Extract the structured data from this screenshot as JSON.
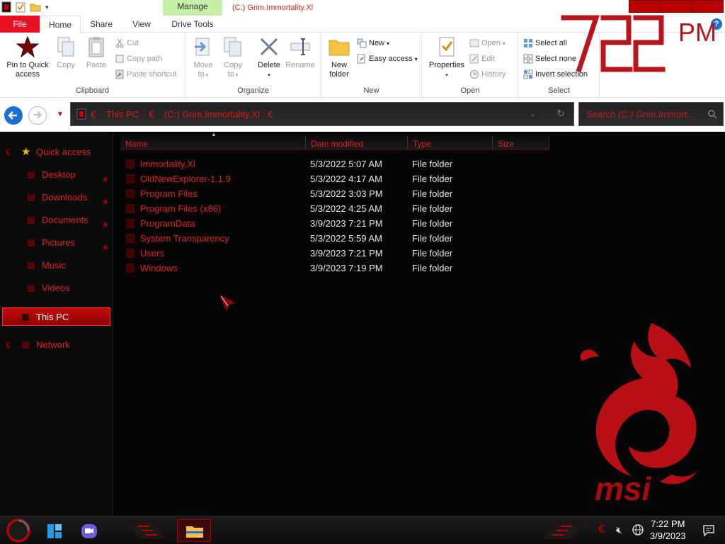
{
  "titlebar": {
    "manage_tab": "Manage",
    "title": "(C:) Grim.Immortality.Xl"
  },
  "tabs": {
    "file": "File",
    "home": "Home",
    "share": "Share",
    "view": "View",
    "drive_tools": "Drive Tools",
    "help": "?"
  },
  "ribbon": {
    "clipboard": {
      "group": "Clipboard",
      "pin_line1": "Pin to Quick",
      "pin_line2": "access",
      "copy": "Copy",
      "paste": "Paste",
      "cut": "Cut",
      "copy_path": "Copy path",
      "paste_shortcut": "Paste shortcut"
    },
    "organize": {
      "group": "Organize",
      "move_line1": "Move",
      "move_line2": "to",
      "copy_line1": "Copy",
      "copy_line2": "to",
      "delete": "Delete",
      "rename": "Rename"
    },
    "new": {
      "group": "New",
      "folder_line1": "New",
      "folder_line2": "folder",
      "new_item": "New",
      "easy_access": "Easy access"
    },
    "open": {
      "group": "Open",
      "properties": "Properties",
      "open": "Open",
      "edit": "Edit",
      "history": "History"
    },
    "select": {
      "group": "Select",
      "select_all": "Select all",
      "select_none": "Select none",
      "invert": "Invert selection"
    }
  },
  "clock_overlay": {
    "digits": "7:22",
    "ampm": "PM"
  },
  "address": {
    "crumb1": "This PC",
    "crumb2": "(C:) Grim.Immortality.Xl",
    "search_placeholder": "Search (C:) Grim.Immort..."
  },
  "navpane": {
    "quick_access": "Quick access",
    "desktop": "Desktop",
    "downloads": "Downloads",
    "documents": "Documents",
    "pictures": "Pictures",
    "music": "Music",
    "videos": "Videos",
    "this_pc": "This PC",
    "network": "Network"
  },
  "columns": {
    "name": "Name",
    "date": "Date modified",
    "type": "Type",
    "size": "Size"
  },
  "files": [
    {
      "name": "Immortality.Xl",
      "date": "5/3/2022 5:07 AM",
      "type": "File folder"
    },
    {
      "name": "OldNewExplorer-1.1.9",
      "date": "5/3/2022 4:17 AM",
      "type": "File folder"
    },
    {
      "name": "Program Files",
      "date": "5/3/2022 3:03 PM",
      "type": "File folder"
    },
    {
      "name": "Program Files (x86)",
      "date": "5/3/2022 4:25 AM",
      "type": "File folder"
    },
    {
      "name": "ProgramData",
      "date": "3/9/2023 7:21 PM",
      "type": "File folder"
    },
    {
      "name": "System Transparency",
      "date": "5/3/2022 5:59 AM",
      "type": "File folder"
    },
    {
      "name": "Users",
      "date": "3/9/2023 7:21 PM",
      "type": "File folder"
    },
    {
      "name": "Windows",
      "date": "3/9/2023 7:19 PM",
      "type": "File folder"
    }
  ],
  "taskbar": {
    "time": "7:22 PM",
    "date": "3/9/2023"
  },
  "colors": {
    "accent_red": "#e02020",
    "file_tab": "#e81123",
    "manage_tab": "#c6f0a8",
    "back_button": "#1a6fd1"
  }
}
